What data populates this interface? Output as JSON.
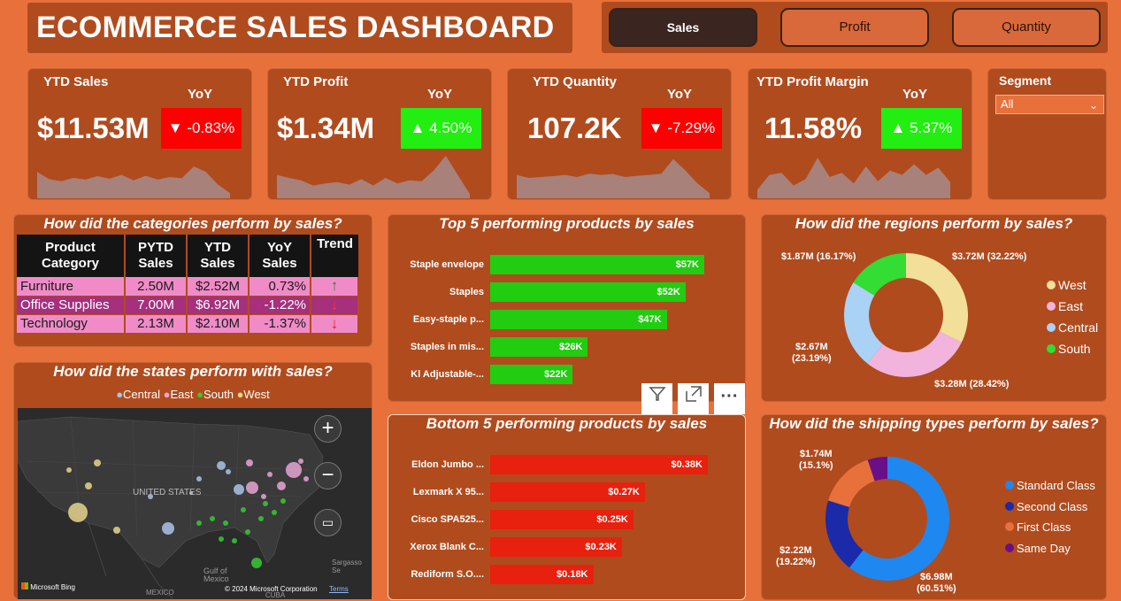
{
  "header": {
    "title": "ECOMMERCE SALES DASHBOARD"
  },
  "nav": {
    "sales": "Sales",
    "profit": "Profit",
    "quantity": "Quantity"
  },
  "kpis": [
    {
      "label": "YTD Sales",
      "value": "$11.53M",
      "yoy_label": "YoY",
      "yoy": "▼ -0.83%",
      "direction": "down",
      "trend": [
        0.62,
        0.45,
        0.4,
        0.48,
        0.44,
        0.52,
        0.46,
        0.55,
        0.42,
        0.53,
        0.44,
        0.5,
        0.47,
        0.75,
        0.62,
        0.32,
        0.12
      ]
    },
    {
      "label": "YTD Profit",
      "value": "$1.34M",
      "yoy_label": "YoY",
      "yoy": "▲  4.50%",
      "direction": "up",
      "trend": [
        0.55,
        0.48,
        0.42,
        0.3,
        0.35,
        0.38,
        0.32,
        0.45,
        0.3,
        0.48,
        0.35,
        0.42,
        0.4,
        0.65,
        1.0,
        0.55,
        0.1
      ]
    },
    {
      "label": "YTD Quantity",
      "value": "107.2K",
      "yoy_label": "YoY",
      "yoy": "▼ -7.29%",
      "direction": "down",
      "trend": [
        0.55,
        0.48,
        0.5,
        0.52,
        0.55,
        0.5,
        0.58,
        0.55,
        0.57,
        0.5,
        0.53,
        0.55,
        0.58,
        0.92,
        0.65,
        0.35,
        0.12
      ]
    },
    {
      "label": "YTD Profit Margin",
      "value": "11.58%",
      "yoy_label": "YoY",
      "yoy": "▲ 5.37%",
      "direction": "up",
      "trend": [
        0.2,
        0.55,
        0.6,
        0.3,
        0.45,
        0.95,
        0.5,
        0.6,
        0.35,
        0.75,
        0.4,
        0.65,
        0.55,
        0.8,
        0.55,
        0.72,
        0.38
      ]
    }
  ],
  "segment": {
    "label": "Segment",
    "selected": "All"
  },
  "categories_table": {
    "title": "How did the categories perform by sales?",
    "headers": [
      "Product Category",
      "PYTD Sales",
      "YTD Sales",
      "YoY Sales",
      "Trend"
    ],
    "rows": [
      {
        "category": "Furniture",
        "pytd": "2.50M",
        "ytd": "$2.52M",
        "yoy": "0.73%",
        "trend": "↑"
      },
      {
        "category": "Office Supplies",
        "pytd": "7.00M",
        "ytd": "$6.92M",
        "yoy": "-1.22%",
        "trend": "↓"
      },
      {
        "category": "Technology",
        "pytd": "2.13M",
        "ytd": "$2.10M",
        "yoy": "-1.37%",
        "trend": "↓"
      }
    ]
  },
  "top5": {
    "title": "Top 5 performing products by sales",
    "color": "#22cc11",
    "items": [
      {
        "name": "Staple envelope",
        "value": 57,
        "label": "$57K"
      },
      {
        "name": "Staples",
        "value": 52,
        "label": "$52K"
      },
      {
        "name": "Easy-staple p...",
        "value": 47,
        "label": "$47K"
      },
      {
        "name": "Staples in mis...",
        "value": 26,
        "label": "$26K"
      },
      {
        "name": "Kl Adjustable-...",
        "value": 22,
        "label": "$22K"
      }
    ]
  },
  "bottom5": {
    "title": "Bottom 5 performing products by sales",
    "color": "#e8200e",
    "items": [
      {
        "name": "Eldon Jumbo ...",
        "value": 0.38,
        "label": "$0.38K"
      },
      {
        "name": "Lexmark X 95...",
        "value": 0.27,
        "label": "$0.27K"
      },
      {
        "name": "Cisco SPA525...",
        "value": 0.25,
        "label": "$0.25K"
      },
      {
        "name": "Xerox Blank C...",
        "value": 0.23,
        "label": "$0.23K"
      },
      {
        "name": "Rediform S.O....",
        "value": 0.18,
        "label": "$0.18K"
      }
    ]
  },
  "regions": {
    "title": "How did the regions perform by sales?",
    "slices": [
      {
        "name": "West",
        "value": 32.22,
        "label": "$3.72M (32.22%)",
        "color": "#f2e09a"
      },
      {
        "name": "East",
        "value": 28.42,
        "label": "$3.28M (28.42%)",
        "color": "#f2b4dc"
      },
      {
        "name": "Central",
        "value": 23.19,
        "label_amount": "$2.67M",
        "label_pct": "(23.19%)",
        "color": "#a9d2f5"
      },
      {
        "name": "South",
        "value": 16.17,
        "label": "$1.87M (16.17%)",
        "color": "#33dd33"
      }
    ]
  },
  "states": {
    "title": "How did the states perform with sales?",
    "legend": [
      {
        "name": "Central",
        "color": "#a9c4e8"
      },
      {
        "name": "East",
        "color": "#e6a6d6"
      },
      {
        "name": "South",
        "color": "#33cc33"
      },
      {
        "name": "West",
        "color": "#e8d48e"
      }
    ],
    "map_labels": {
      "country": "UNITED STATES",
      "gulf": "Gulf of Mexico",
      "mexico": "MEXICO",
      "cuba": "CUBA",
      "sargasso": "Sargasso Se",
      "bing": "Microsoft Bing",
      "copyright": "© 2024 Microsoft Corporation",
      "terms": "Terms"
    }
  },
  "shipping": {
    "title": "How did the shipping types perform by sales?",
    "slices": [
      {
        "name": "Standard Class",
        "value": 60.51,
        "amount": "$6.98M",
        "pct": "(60.51%)",
        "color": "#1e88f0"
      },
      {
        "name": "Second Class",
        "value": 19.22,
        "amount": "$2.22M",
        "pct": "(19.22%)",
        "color": "#1a2aa8"
      },
      {
        "name": "First Class",
        "value": 15.1,
        "amount": "$1.74M",
        "pct": "(15.1%)",
        "color": "#e8713b"
      },
      {
        "name": "Same Day",
        "value": 5.17,
        "color": "#6a0f8a"
      }
    ]
  },
  "toolbar": {
    "filter_icon": "filter-icon",
    "focus_icon": "focus-mode-icon",
    "more": "···"
  }
}
